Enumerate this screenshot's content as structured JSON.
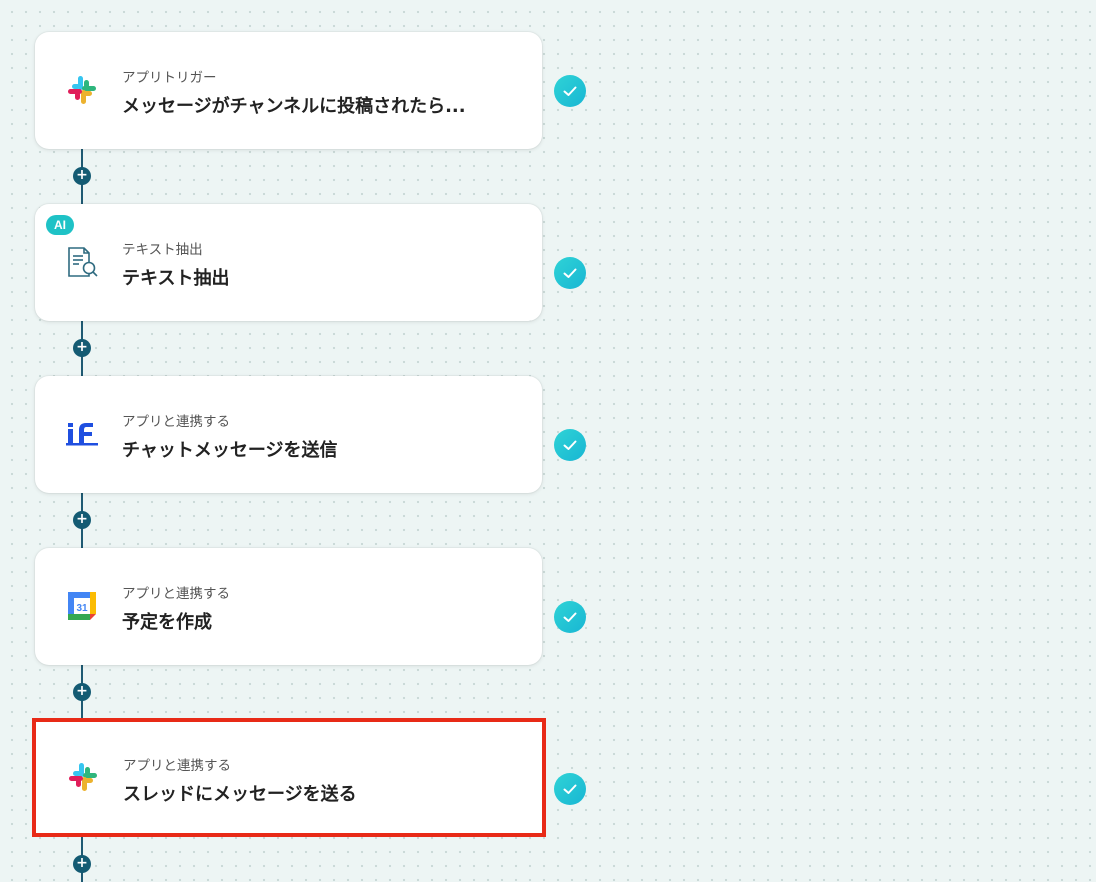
{
  "steps": [
    {
      "type": "アプリトリガー",
      "title": "メッセージがチャンネルに投稿されたら...",
      "icon": "slack-icon",
      "status": "completed"
    },
    {
      "type": "テキスト抽出",
      "title": "テキスト抽出",
      "icon": "document-search-icon",
      "badge": "AI",
      "status": "completed"
    },
    {
      "type": "アプリと連携する",
      "title": "チャットメッセージを送信",
      "icon": "if-logo-icon",
      "status": "completed"
    },
    {
      "type": "アプリと連携する",
      "title": "予定を作成",
      "icon": "google-calendar-icon",
      "status": "completed"
    },
    {
      "type": "アプリと連携する",
      "title": "スレッドにメッセージを送る",
      "icon": "slack-icon",
      "status": "completed",
      "highlighted": true
    }
  ],
  "add_button_label": "+",
  "colors": {
    "background": "#edf5f4",
    "connector": "#145b73",
    "check": "#22c3d5",
    "highlight": "#e82a17",
    "ai_badge": "#1ec2c6"
  }
}
